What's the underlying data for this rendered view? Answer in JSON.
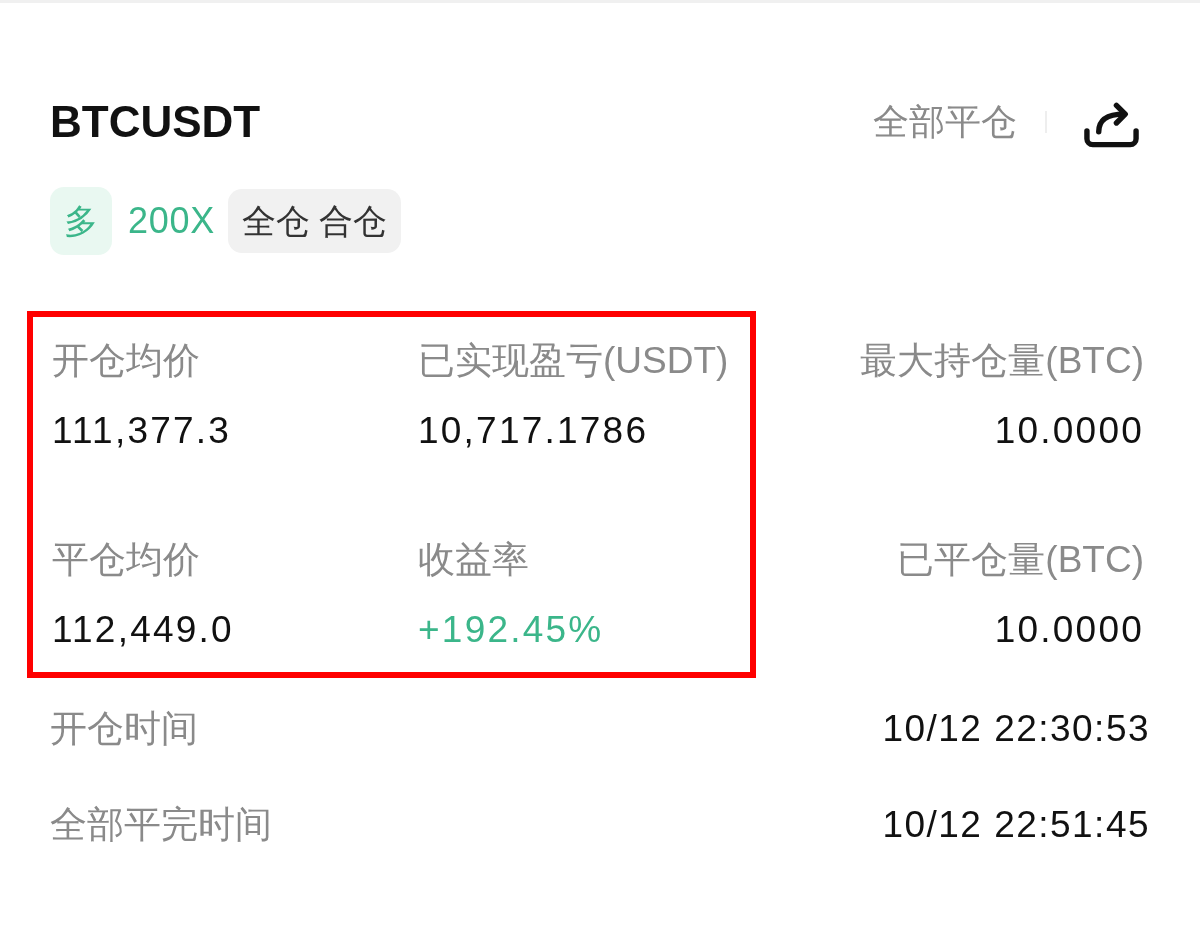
{
  "header": {
    "symbol": "BTCUSDT",
    "close_all_button": "全部平仓"
  },
  "tags": [
    {
      "kind": "side",
      "label": "多"
    },
    {
      "kind": "leverage",
      "label": "200X"
    },
    {
      "kind": "mode",
      "label": "全仓 合仓"
    }
  ],
  "stat_groups": [
    {
      "highlighted": true,
      "kind": "grid",
      "items": [
        {
          "label": "开仓均价",
          "value": "111,377.3",
          "kind": "plain"
        },
        {
          "label": "已实现盈亏(USDT)",
          "value": "10,717.1786",
          "kind": "plain"
        },
        {
          "label": "平仓均价",
          "value": "112,449.0",
          "kind": "plain"
        },
        {
          "label": "收益率",
          "value": "+192.45%",
          "kind": "gain"
        }
      ]
    },
    {
      "highlighted": false,
      "kind": "column",
      "items": [
        {
          "label": "最大持仓量(BTC)",
          "value": "10.0000",
          "kind": "plain"
        },
        {
          "label": "已平仓量(BTC)",
          "value": "10.0000",
          "kind": "plain"
        }
      ]
    }
  ],
  "times": [
    {
      "label": "开仓时间",
      "value": "10/12 22:30:53"
    },
    {
      "label": "全部平完时间",
      "value": "10/12 22:51:45"
    }
  ]
}
